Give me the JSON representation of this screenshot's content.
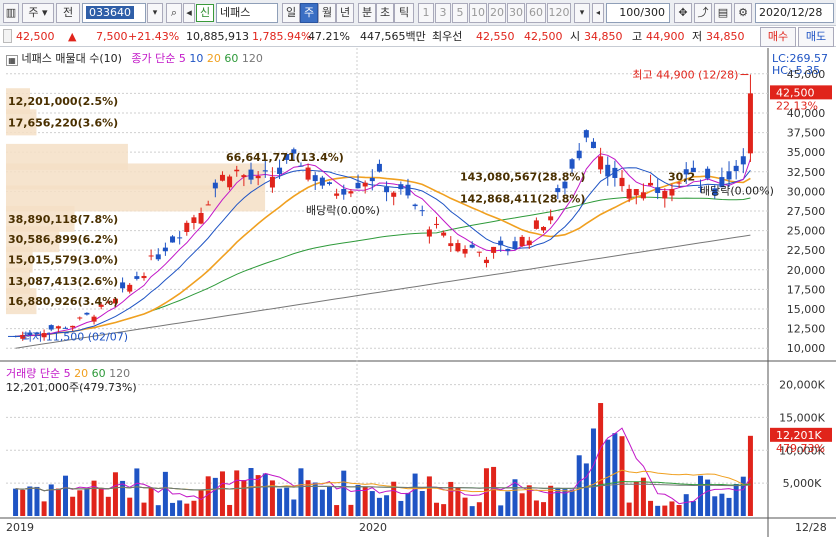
{
  "toolbar": {
    "tab1": "주",
    "tab2": "전",
    "code": "033640",
    "name_badge": "신",
    "stock_name": "네패스",
    "periods": [
      "일",
      "주",
      "월",
      "년",
      "분",
      "초",
      "틱"
    ],
    "active_period": "주",
    "nums": [
      "1",
      "3",
      "5",
      "10",
      "20",
      "30",
      "60",
      "120"
    ],
    "count": "100",
    "count_total": "/300",
    "date": "2020/12/28"
  },
  "quote": {
    "price": "42,500",
    "arrow": "▲",
    "change": "7,500",
    "pct": "+21.43%",
    "volume": "10,885,913",
    "vol_ratio": "1,785.94%",
    "turnover": "47.21%",
    "amount": "447,565백만",
    "priority_label": "최우선",
    "priority_sell": "42,550",
    "priority_buy": "42,500",
    "open_label": "시",
    "open": "34,850",
    "high_label": "고",
    "high": "44,900",
    "low_label": "저",
    "low": "34,850",
    "buy_btn": "매수",
    "sell_btn": "매도"
  },
  "price_panel": {
    "title": "네패스 매물대 수(10)",
    "ma_label": "종가 단순",
    "ma5": "5",
    "ma10": "10",
    "ma20": "20",
    "ma60": "60",
    "ma120": "120",
    "lc": "LC:269.57",
    "hc": "HC:-5.35",
    "high_note": "최고 44,900 (12/28)",
    "low_note": "최저 11,500 (02/07)",
    "div1": "배당락(0.00%)",
    "div2": "배당락(0.00%)",
    "last_price": "42,500",
    "last_pct": "22.13%",
    "y_ticks": [
      "45,000",
      "42,500",
      "40,000",
      "37,500",
      "35,000",
      "32,500",
      "30,000",
      "27,500",
      "25,000",
      "22,500",
      "20,000",
      "17,500",
      "15,000",
      "12,500",
      "10,000"
    ],
    "profile": [
      {
        "label": "12,201,000(2.5%)",
        "price": 41.5,
        "width": 0.03
      },
      {
        "label": "17,656,220(3.6%)",
        "price": 38.8,
        "width": 0.04
      },
      {
        "label": "66,641,771(13.4%)",
        "price": 34.4,
        "width": 0.16
      },
      {
        "label": "143,080,567(28.8%)",
        "price": 31.9,
        "width": 0.34
      },
      {
        "label": "142,868,411(28.8%)",
        "price": 29.1,
        "width": 0.34
      },
      {
        "label": "38,890,118(7.8%)",
        "price": 26.5,
        "width": 0.09
      },
      {
        "label": "30,586,899(6.2%)",
        "price": 23.9,
        "width": 0.07
      },
      {
        "label": "15,015,579(3.0%)",
        "price": 21.3,
        "width": 0.035
      },
      {
        "label": "13,087,413(2.6%)",
        "price": 18.6,
        "width": 0.03
      },
      {
        "label": "16,880,926(3.4%)",
        "price": 16.0,
        "width": 0.04
      }
    ],
    "extra_label": "30,2"
  },
  "volume_panel": {
    "title": "거래량",
    "ma_label": "단순",
    "ma5": "5",
    "ma20": "20",
    "ma60": "60",
    "ma120": "120",
    "info": "12,201,000주(479.73%)",
    "y_ticks": [
      "20,000K",
      "15,000K",
      "10,000K",
      "5,000K"
    ],
    "last_vol": "12,201K",
    "last_pct": "479.73%"
  },
  "x_axis": {
    "start": "2019",
    "mid": "2020",
    "end": "12/28"
  },
  "colors": {
    "up": "#e0241b",
    "down": "#1f54c4",
    "ma5": "#c218c8",
    "ma10": "#1f54c4",
    "ma20": "#f0a020",
    "ma60": "#2e9a3a",
    "ma120": "#777777",
    "profile": "#f4dfc6"
  }
}
